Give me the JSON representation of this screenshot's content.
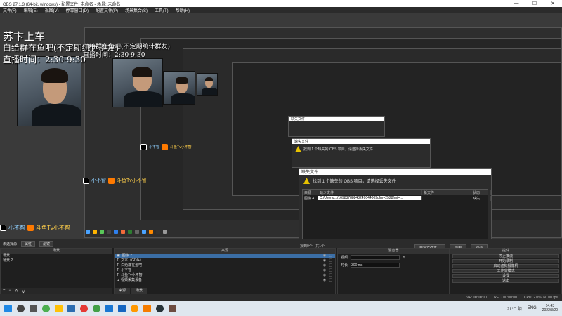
{
  "window": {
    "title": "OBS 27.1.3 (64-bit, windows) - 配置文件: 未命名 - 场景: 未命名",
    "controls": [
      "—",
      "☐",
      "✕"
    ]
  },
  "menubar": [
    "文件(F)",
    "编辑(E)",
    "视图(V)",
    "停靠窗口(D)",
    "配置文件(P)",
    "场景集合(S)",
    "工具(T)",
    "帮助(H)"
  ],
  "overlay": {
    "title": "苏卞上车",
    "line1": "白给群在鱼吧(不定期统计群友)",
    "line2": "直播时间：2:30-9:30"
  },
  "social": {
    "douyin": "小不智",
    "douyu": "斗鱼Tv小不智"
  },
  "dialog_big": {
    "title": "缺失文件",
    "warning": "找到 1 个缺失的 OBS 项目，请选择丢失文件",
    "columns": [
      "来源",
      "缺少文件",
      "新文件",
      "状态"
    ],
    "row": {
      "source": "图像 4",
      "missing": "C:/Users/.../16983788843249044009dfm=2528fmt=...",
      "new": "",
      "status": "缺失"
    }
  },
  "dialog_mid": {
    "title": "缺失文件",
    "warning": "找到 1 个缺失的 OBS 项目，请选择丢失文件"
  },
  "dialog_small": {
    "title": "缺失文件"
  },
  "found_bar": "找到0个 - 共1个",
  "dlg_buttons": [
    "查找文件夹…",
    "应用",
    "取消"
  ],
  "dock_strip": {
    "label": "未选择源",
    "properties": "属性",
    "filters": "滤镜"
  },
  "scenes": {
    "header": "场景",
    "items": [
      "场景",
      "场景 2"
    ]
  },
  "sources": {
    "header": "来源",
    "items": [
      "图像 2",
      "文本（GDI+）",
      "白给群在鱼吧",
      "小不智",
      "斗鱼Tv小不智",
      "视频采集设备"
    ],
    "tabs": [
      "来源",
      "场景"
    ]
  },
  "mixer": {
    "header": "混音器",
    "input_label": "视频",
    "duration_label": "时长",
    "duration_value": "300 ms"
  },
  "controls": {
    "header": "控件",
    "buttons": [
      "停止推流",
      "开始录制",
      "启动虚拟摄像机",
      "工作室模式",
      "设置",
      "退出"
    ]
  },
  "status": {
    "live": "LIVE: 00:00:00",
    "rec": "REC: 00:00:00",
    "cpu": "CPU: 2.0%, 60.00 fps"
  },
  "taskbar": {
    "weather": "21°C 阴",
    "lang": "ENG",
    "time": "14:43",
    "date": "2022/3/20"
  }
}
